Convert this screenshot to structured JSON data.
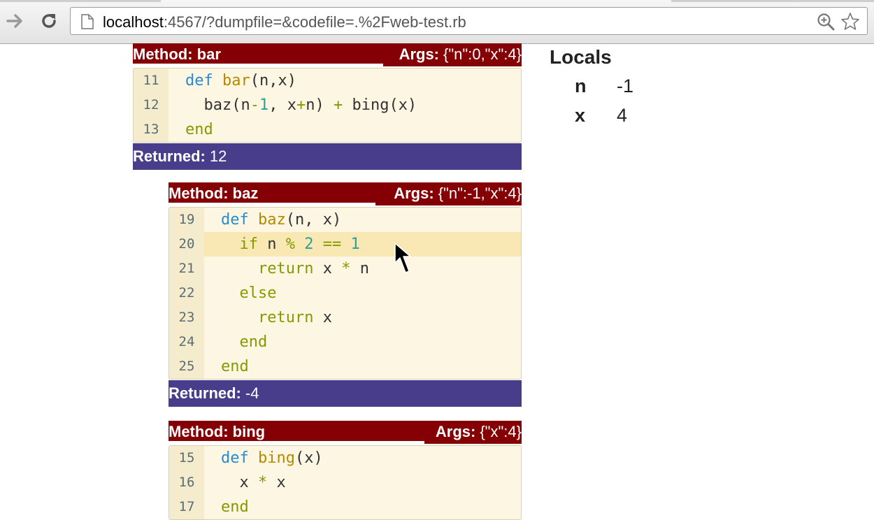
{
  "browser": {
    "url_host": "localhost",
    "url_rest": ":4567/?dumpfile=&codefile=.%2Fweb-test.rb",
    "icons": [
      "forward-arrow-icon",
      "reload-icon",
      "page-icon",
      "zoom-icon",
      "star-icon"
    ]
  },
  "frames": [
    {
      "method_label": "Method: bar",
      "args_label": "Args:",
      "args_value": "{\"n\":0,\"x\":4}",
      "lines": [
        {
          "num": "11",
          "code": "def bar(n,x)"
        },
        {
          "num": "12",
          "code": "  baz(n-1, x+n) + bing(x)"
        },
        {
          "num": "13",
          "code": "end"
        }
      ],
      "returned_label": "Returned:",
      "returned_value": "12"
    },
    {
      "method_label": "Method: baz",
      "args_label": "Args:",
      "args_value": "{\"n\":-1,\"x\":4}",
      "lines": [
        {
          "num": "19",
          "code": "def baz(n, x)"
        },
        {
          "num": "20",
          "code": "  if n % 2 == 1",
          "highlighted": true
        },
        {
          "num": "21",
          "code": "    return x * n"
        },
        {
          "num": "22",
          "code": "  else"
        },
        {
          "num": "23",
          "code": "    return x"
        },
        {
          "num": "24",
          "code": "  end"
        },
        {
          "num": "25",
          "code": "end"
        }
      ],
      "returned_label": "Returned:",
      "returned_value": "-4"
    },
    {
      "method_label": "Method: bing",
      "args_label": "Args:",
      "args_value": "{\"x\":4}",
      "lines": [
        {
          "num": "15",
          "code": "def bing(x)"
        },
        {
          "num": "16",
          "code": "  x * x"
        },
        {
          "num": "17",
          "code": "end"
        }
      ]
    }
  ],
  "locals": {
    "title": "Locals",
    "vars": [
      {
        "name": "n",
        "value": "-1"
      },
      {
        "name": "x",
        "value": "4"
      }
    ]
  },
  "colors": {
    "method_bar": "#850004",
    "returned_bar": "#483d8b",
    "code_bg": "#fdf6e3",
    "highlight_line": "#f9e8b4"
  }
}
